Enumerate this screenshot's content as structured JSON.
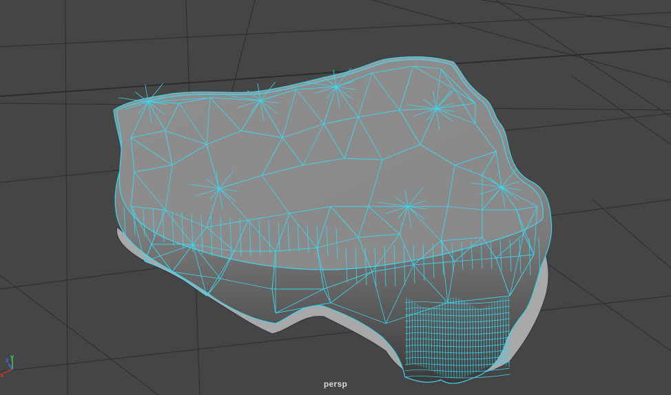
{
  "viewport": {
    "camera_name": "persp",
    "background_color": "#454545",
    "grid_color": "#2c2c2c",
    "wireframe_color": "#3fd6f0",
    "mesh_shade_color": "#8d8d8d"
  },
  "axis_gizmo": {
    "x_label": "x",
    "y_label": "y",
    "z_label": "z",
    "x_color": "#e0303a",
    "y_color": "#41d35a",
    "z_color": "#3f6df2"
  },
  "mesh": {
    "name": "selected-polygon-mesh",
    "display_mode": "wireframe-on-shaded",
    "selected": true
  }
}
